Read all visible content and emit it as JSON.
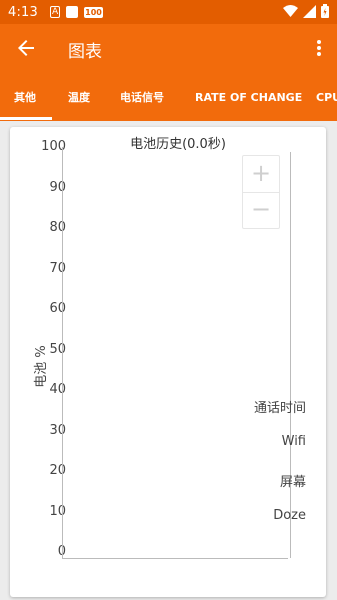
{
  "status_bar": {
    "time": "4:13",
    "icons": [
      "notification-a-icon",
      "square-notification-icon",
      "100-notification-icon",
      "wifi-icon",
      "signal-icon",
      "battery-icon"
    ],
    "a_glyph": "A",
    "hundred_glyph": "100"
  },
  "app_bar": {
    "title": "图表",
    "back_icon": "arrow-back-icon",
    "menu_icon": "more-vert-icon"
  },
  "tabs": [
    {
      "label": "其他",
      "selected": true
    },
    {
      "label": "温度",
      "selected": false
    },
    {
      "label": "电话信号",
      "selected": false
    },
    {
      "label": "RATE OF CHANGE",
      "selected": false
    },
    {
      "label": "CPU",
      "selected": false
    }
  ],
  "chart": {
    "title": "电池历史(0.0秒)",
    "y_axis_label": "电池 %",
    "y_ticks": [
      "100",
      "90",
      "80",
      "70",
      "60",
      "50",
      "40",
      "30",
      "20",
      "10",
      "0"
    ],
    "zoom_in": "+",
    "zoom_out": "−",
    "state_labels": [
      "通话时间",
      "Wifi",
      "屏幕",
      "Doze"
    ]
  },
  "colors": {
    "status_bar": "#e35d00",
    "app_bar": "#f26b0c",
    "background": "#ececec",
    "card": "#ffffff"
  },
  "chart_data": {
    "type": "line",
    "title": "电池历史(0.0秒)",
    "ylabel": "电池 %",
    "ylim": [
      0,
      100
    ],
    "y_ticks": [
      100,
      90,
      80,
      70,
      60,
      50,
      40,
      30,
      20,
      10,
      0
    ],
    "series": [],
    "state_rows": [
      "通话时间",
      "Wifi",
      "屏幕",
      "Doze"
    ]
  }
}
